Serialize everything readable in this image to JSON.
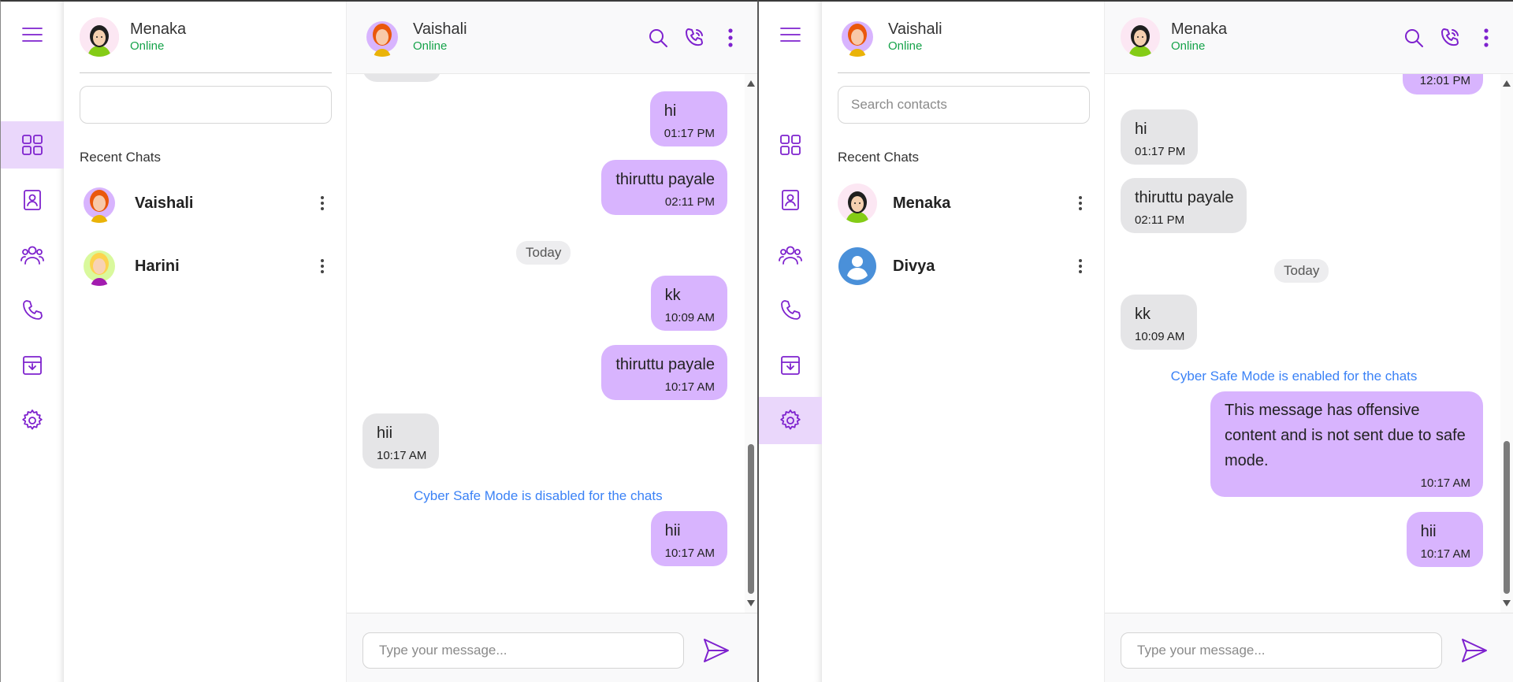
{
  "colors": {
    "accent": "#7e22ce",
    "outgoing_bubble": "#d8b4fe",
    "incoming_bubble": "#e5e5e7",
    "online": "#16a34a",
    "notice": "#3b82f6",
    "active_rail": "#ead7fb"
  },
  "rail_icons": [
    "menu-icon",
    "grid-icon",
    "contacts-book-icon",
    "group-icon",
    "phone-icon",
    "archive-icon",
    "settings-icon"
  ],
  "left": {
    "user": {
      "name": "Menaka",
      "status": "Online"
    },
    "search": {
      "value": "",
      "placeholder": ""
    },
    "recent_label": "Recent Chats",
    "contacts": [
      {
        "name": "Vaishali"
      },
      {
        "name": "Harini"
      }
    ],
    "chat": {
      "name": "Vaishali",
      "status": "Online"
    },
    "messages": [
      {
        "text": "hi",
        "time": "01:17 PM"
      },
      {
        "text": "thiruttu payale",
        "time": "02:11 PM"
      },
      {
        "text": "Today"
      },
      {
        "text": "kk",
        "time": "10:09 AM"
      },
      {
        "text": "thiruttu payale",
        "time": "10:17 AM"
      },
      {
        "text": "hii",
        "time": "10:17 AM"
      },
      {
        "text": "Cyber Safe Mode is disabled for the chats"
      },
      {
        "text": "hii",
        "time": "10:17 AM"
      }
    ],
    "composer_placeholder": "Type your message..."
  },
  "right": {
    "user": {
      "name": "Vaishali",
      "status": "Online"
    },
    "search": {
      "value": "",
      "placeholder": "Search contacts"
    },
    "recent_label": "Recent Chats",
    "contacts": [
      {
        "name": "Menaka"
      },
      {
        "name": "Divya"
      }
    ],
    "chat": {
      "name": "Menaka",
      "status": "Online"
    },
    "messages": [
      {
        "text": "",
        "time": "12:01 PM"
      },
      {
        "text": "hi",
        "time": "01:17 PM"
      },
      {
        "text": "thiruttu payale",
        "time": "02:11 PM"
      },
      {
        "text": "Today"
      },
      {
        "text": "kk",
        "time": "10:09 AM"
      },
      {
        "text": "Cyber Safe Mode is enabled for the chats"
      },
      {
        "text": "This message has offensive content and is not sent due to safe mode.",
        "time": "10:17 AM"
      },
      {
        "text": "hii",
        "time": "10:17 AM"
      }
    ],
    "composer_placeholder": "Type your message..."
  }
}
